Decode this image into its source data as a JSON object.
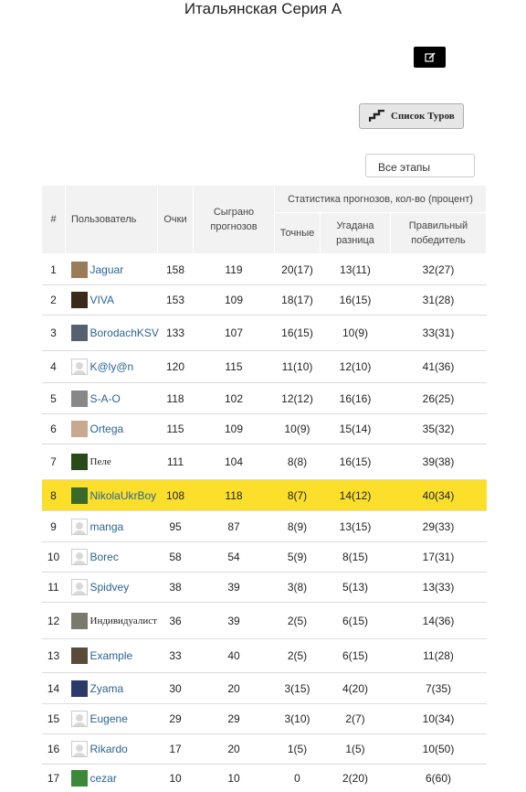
{
  "page": {
    "title": "Итальянская Серия А"
  },
  "toolbar": {
    "rounds_label": "Список Туров"
  },
  "filter": {
    "stage_value": "Все этапы"
  },
  "table": {
    "headers": {
      "rank": "#",
      "user": "Пользователь",
      "points": "Очки",
      "played": "Сыграно прогнозов",
      "stats_group": "Статистика прогнозов, кол-во (процент)",
      "exact": "Точные",
      "diff": "Угадана разница",
      "winner": "Правильный победитель"
    },
    "rows": [
      {
        "rank": "1",
        "user": "Jaguar",
        "points": "158",
        "played": "119",
        "exact": "20(17)",
        "diff": "13(11)",
        "winner": "32(27)",
        "avatar": "photo",
        "color": "#9a7b5a"
      },
      {
        "rank": "2",
        "user": "VIVA",
        "points": "153",
        "played": "109",
        "exact": "18(17)",
        "diff": "16(15)",
        "winner": "31(28)",
        "avatar": "photo",
        "color": "#3a2a1a"
      },
      {
        "rank": "3",
        "user": "BorodachKSV",
        "points": "133",
        "played": "107",
        "exact": "16(15)",
        "diff": "10(9)",
        "winner": "33(31)",
        "avatar": "photo",
        "color": "#556070"
      },
      {
        "rank": "4",
        "user": "K@ly@n",
        "points": "120",
        "played": "115",
        "exact": "11(10)",
        "diff": "12(10)",
        "winner": "41(36)",
        "avatar": "default"
      },
      {
        "rank": "5",
        "user": "S-A-O",
        "points": "118",
        "played": "102",
        "exact": "12(12)",
        "diff": "16(16)",
        "winner": "26(25)",
        "avatar": "photo",
        "color": "#888888"
      },
      {
        "rank": "6",
        "user": "Ortega",
        "points": "115",
        "played": "109",
        "exact": "10(9)",
        "diff": "15(14)",
        "winner": "35(32)",
        "avatar": "photo",
        "color": "#c8a890"
      },
      {
        "rank": "7",
        "user": "Пеле",
        "points": "111",
        "played": "104",
        "exact": "8(8)",
        "diff": "16(15)",
        "winner": "39(38)",
        "avatar": "photo",
        "color": "#2a4a1a",
        "serif": true
      },
      {
        "rank": "8",
        "user": "NikolaUkrBoy",
        "points": "108",
        "played": "118",
        "exact": "8(7)",
        "diff": "14(12)",
        "winner": "40(34)",
        "avatar": "photo",
        "color": "#3a6a2a",
        "highlight": true
      },
      {
        "rank": "9",
        "user": "manga",
        "points": "95",
        "played": "87",
        "exact": "8(9)",
        "diff": "13(15)",
        "winner": "29(33)",
        "avatar": "default"
      },
      {
        "rank": "10",
        "user": "Borec",
        "points": "58",
        "played": "54",
        "exact": "5(9)",
        "diff": "8(15)",
        "winner": "17(31)",
        "avatar": "default"
      },
      {
        "rank": "11",
        "user": "Spidvey",
        "points": "38",
        "played": "39",
        "exact": "3(8)",
        "diff": "5(13)",
        "winner": "13(33)",
        "avatar": "default"
      },
      {
        "rank": "12",
        "user": "Индивидуалист",
        "points": "36",
        "played": "39",
        "exact": "2(5)",
        "diff": "6(15)",
        "winner": "14(36)",
        "avatar": "photo",
        "color": "#7a7a6a",
        "serif": true
      },
      {
        "rank": "13",
        "user": "Example",
        "points": "33",
        "played": "40",
        "exact": "2(5)",
        "diff": "6(15)",
        "winner": "11(28)",
        "avatar": "photo",
        "color": "#5a4a3a"
      },
      {
        "rank": "14",
        "user": "Zyama",
        "points": "30",
        "played": "20",
        "exact": "3(15)",
        "diff": "4(20)",
        "winner": "7(35)",
        "avatar": "photo",
        "color": "#2a3a6a"
      },
      {
        "rank": "15",
        "user": "Eugene",
        "points": "29",
        "played": "29",
        "exact": "3(10)",
        "diff": "2(7)",
        "winner": "10(34)",
        "avatar": "default"
      },
      {
        "rank": "16",
        "user": "Rikardo",
        "points": "17",
        "played": "20",
        "exact": "1(5)",
        "diff": "1(5)",
        "winner": "10(50)",
        "avatar": "default"
      },
      {
        "rank": "17",
        "user": "cezar",
        "points": "10",
        "played": "10",
        "exact": "0",
        "diff": "2(20)",
        "winner": "6(60)",
        "avatar": "photo",
        "color": "#3a8a3a"
      }
    ]
  }
}
